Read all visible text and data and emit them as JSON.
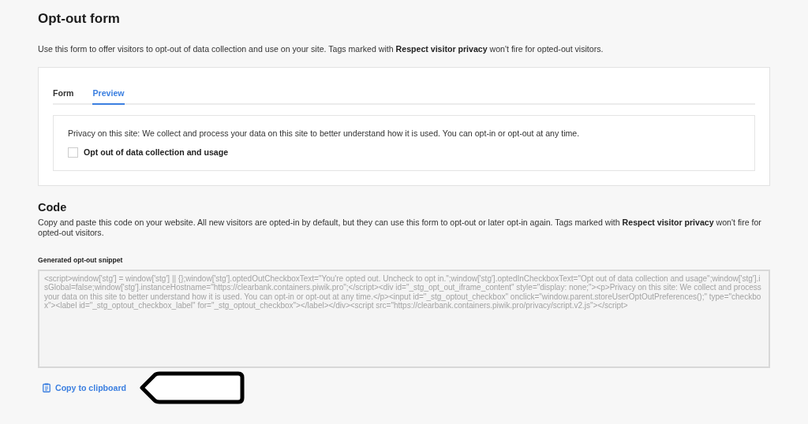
{
  "title": "Opt-out form",
  "intro": "Use this form to offer visitors to opt-out of data collection and use on your site. Tags marked with **Respect visitor privacy** won't fire for opted-out visitors.",
  "tabs": [
    {
      "label": "Form",
      "selected": false
    },
    {
      "label": "Preview",
      "selected": true
    }
  ],
  "preview": {
    "text": "Privacy on this site: We collect and process your data on this site to better understand how it is used. You can opt-in or opt-out at any time.",
    "checkbox": {
      "label": "Opt out of data collection and usage",
      "checked": false
    }
  },
  "code": {
    "heading": "Code",
    "description": "Copy and paste this code on your website. All new visitors are opted-in by default, but they can use this form to opt-out or later opt-in again. Tags marked with **Respect visitor privacy** won't fire for opted-out visitors.",
    "snippet_label": "Generated opt-out snippet",
    "snippet": "<script>window['stg'] = window['stg'] || {};window['stg'].optedOutCheckboxText=\"You're opted out. Uncheck to opt in.\";window['stg'].optedInCheckboxText=\"Opt out of data collection and usage\";window['stg'].isGlobal=false;window['stg'].instanceHostname=\"https://clearbank.containers.piwik.pro\";</script><div id=\"_stg_opt_out_iframe_content\" style=\"display: none;\"><p>Privacy on this site: We collect and process your data on this site to better understand how it is used. You can opt-in or opt-out at any time.</p><input id=\"_stg_optout_checkbox\" onclick=\"window.parent.storeUserOptOutPreferences();\" type=\"checkbox\"><label id=\"_stg_optout_checkbox_label\" for=\"_stg_optout_checkbox\"></label></div><script src=\"https://clearbank.containers.piwik.pro/privacy/script.v2.js\"></script>",
    "copy_button": "Copy to clipboard"
  }
}
